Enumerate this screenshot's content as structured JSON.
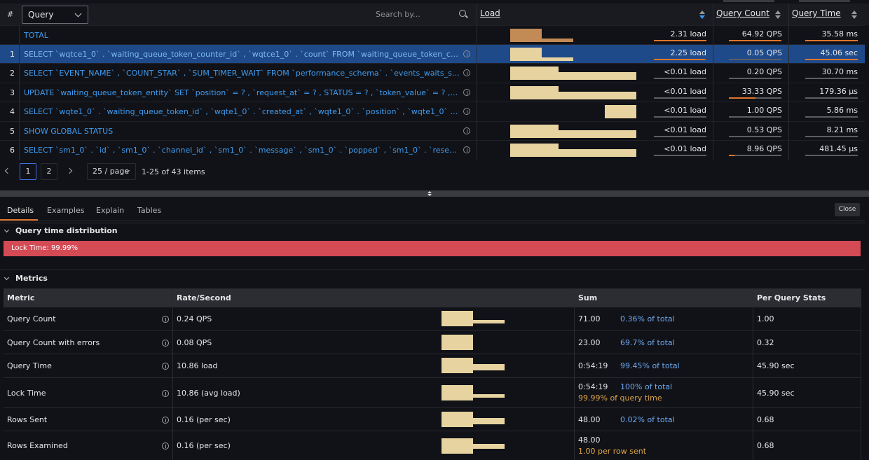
{
  "toolbar": {
    "hash_label": "#",
    "group_by_value": "Query",
    "search_placeholder": "Search by...",
    "columns": {
      "load": "Load",
      "query_count": "Query Count",
      "query_time": "Query Time"
    }
  },
  "rows": [
    {
      "num": "",
      "text": "TOTAL",
      "load": "2.31 load",
      "qps": "64.92 QPS",
      "qtime": "35.58 ms",
      "load_share": 1.0,
      "qps_share": 1.0,
      "qtime_share": 1.0
    },
    {
      "num": "1",
      "text": "SELECT `wqtce1_0` . `waiting_queue_token_counter_id` , `wqtce1_0` . `count` FROM `waiting_queue_token_counter_entity` `wqtce1_0` WHERE ...",
      "load": "2.25 load",
      "qps": "0.05 QPS",
      "qtime": "45.06 sec",
      "load_share": 0.97,
      "qps_share": 0.0,
      "qtime_share": 1.0
    },
    {
      "num": "2",
      "text": "SELECT `EVENT_NAME` , `COUNT_STAR` , `SUM_TIMER_WAIT` FROM `performance_schema` . `events_waits_summary_global_by_event_name` ...",
      "load": "<0.01 load",
      "qps": "0.20 QPS",
      "qtime": "30.70 ms",
      "load_share": 0.0,
      "qps_share": 0.0,
      "qtime_share": 0.0
    },
    {
      "num": "3",
      "text": "UPDATE `waiting_queue_token_entity` SET `position` = ? , `request_at` = ? , STATUS = ? , `token_value` = ? , `user_id` = ? , `valid_until` = ? ...",
      "load": "<0.01 load",
      "qps": "33.33 QPS",
      "qtime": "179.36 µs",
      "load_share": 0.0,
      "qps_share": 0.5,
      "qtime_share": 0.0
    },
    {
      "num": "4",
      "text": "SELECT `wqte1_0` . `waiting_queue_token_id` , `wqte1_0` . `created_at` , `wqte1_0` . `position` , `wqte1_0` . `request_at` , `wqte1_0` . ...",
      "load": "<0.01 load",
      "qps": "1.00 QPS",
      "qtime": "5.86 ms",
      "load_share": 0.0,
      "qps_share": 0.0,
      "qtime_share": 0.0
    },
    {
      "num": "5",
      "text": "SHOW GLOBAL STATUS",
      "load": "<0.01 load",
      "qps": "0.53 QPS",
      "qtime": "8.21 ms",
      "load_share": 0.0,
      "qps_share": 0.0,
      "qtime_share": 0.0
    },
    {
      "num": "6",
      "text": "SELECT `sm1_0` . `id` , `sm1_0` . `channel_id` , `sm1_0` . `message` , `sm1_0` . `popped` , `sm1_0` . `reserved_at` , `sm1_0` . `sent` ...",
      "load": "<0.01 load",
      "qps": "8.96 QPS",
      "qtime": "481.45 µs",
      "load_share": 0.0,
      "qps_share": 0.1,
      "qtime_share": 0.0
    }
  ],
  "pagination": {
    "page1": "1",
    "page2": "2",
    "page_size": "25 / page",
    "info": "1-25 of 43 items"
  },
  "tabs": [
    "Details",
    "Examples",
    "Explain",
    "Tables"
  ],
  "close_label": "Close",
  "distribution": {
    "title": "Query time distribution",
    "lock_label": "Lock Time: 99.99%",
    "lock_color": "#d44a55"
  },
  "metrics": {
    "title": "Metrics",
    "headers": [
      "Metric",
      "Rate/Second",
      "Sum",
      "Per Query Stats"
    ],
    "rows": [
      {
        "name": "Query Count",
        "rate": "0.24 QPS",
        "sum": "71.00",
        "pct": "0.36% of total",
        "sub": "",
        "per": "1.00"
      },
      {
        "name": "Query Count with errors",
        "rate": "0.08 QPS",
        "sum": "23.00",
        "pct": "69.7% of total",
        "sub": "",
        "per": "0.32"
      },
      {
        "name": "Query Time",
        "rate": "10.86 load",
        "sum": "0:54:19",
        "pct": "99.45% of total",
        "sub": "",
        "per": "45.90 sec"
      },
      {
        "name": "Lock Time",
        "rate": "10.86 (avg load)",
        "sum": "0:54:19",
        "pct": "100% of total",
        "sub": "99.99% of query time",
        "per": "45.90 sec"
      },
      {
        "name": "Rows Sent",
        "rate": "0.16 (per sec)",
        "sum": "48.00",
        "pct": "0.02% of total",
        "sub": "",
        "per": "0.68"
      },
      {
        "name": "Rows Examined",
        "rate": "0.16 (per sec)",
        "sum": "48.00",
        "pct": "",
        "sub": "1.00 per row sent",
        "per": "0.68"
      }
    ]
  },
  "colors": {
    "accent": "#e0752d",
    "link": "#3d9bf0",
    "sparkline": "#e6d3a0",
    "selected_row": "#1f4a8a"
  }
}
